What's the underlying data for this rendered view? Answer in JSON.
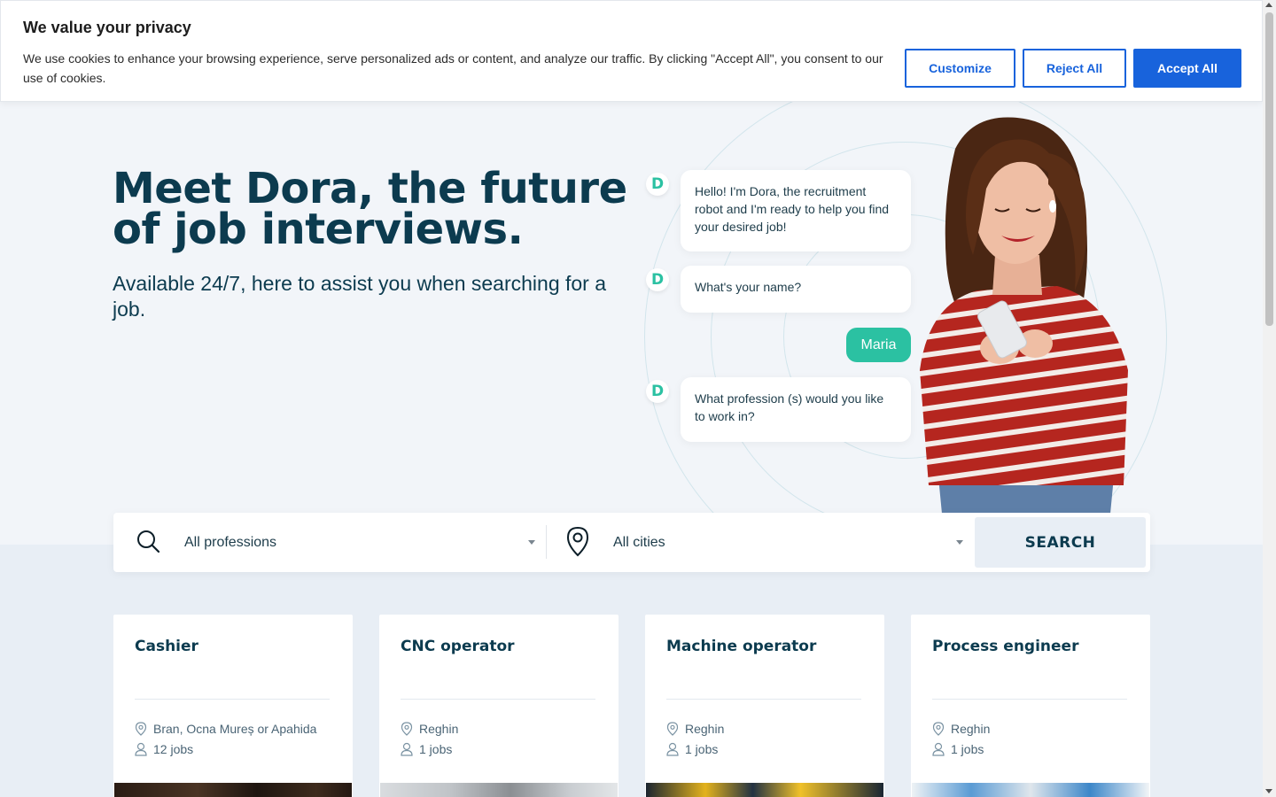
{
  "cookie_banner": {
    "title": "We value your privacy",
    "text": "We use cookies to enhance your browsing experience, serve personalized ads or content, and analyze our traffic. By clicking \"Accept All\", you consent to our use of cookies.",
    "customize_label": "Customize",
    "reject_label": "Reject All",
    "accept_label": "Accept All"
  },
  "hero": {
    "title": "Meet Dora, the future of job interviews.",
    "subtitle": "Available 24/7, here to assist you when searching for a job."
  },
  "chat": {
    "badge_letter": "D",
    "messages": [
      "Hello! I'm Dora, the recruitment robot and I'm ready to help you find your desired job!",
      "What's your name?",
      "What profession (s) would you like to work in?"
    ],
    "user_reply": "Maria"
  },
  "search": {
    "profession_value": "All professions",
    "city_value": "All cities",
    "button_label": "SEARCH"
  },
  "cards": [
    {
      "title": "Cashier",
      "location": "Bran, Ocna Mureș or Apahida",
      "jobs": "12 jobs"
    },
    {
      "title": "CNC operator",
      "location": "Reghin",
      "jobs": "1 jobs"
    },
    {
      "title": "Machine operator",
      "location": "Reghin",
      "jobs": "1 jobs"
    },
    {
      "title": "Process engineer",
      "location": "Reghin",
      "jobs": "1 jobs"
    }
  ],
  "colors": {
    "accent_blue": "#1863dc",
    "brand_teal": "#2bc1a2",
    "navy": "#0c3b4f"
  }
}
